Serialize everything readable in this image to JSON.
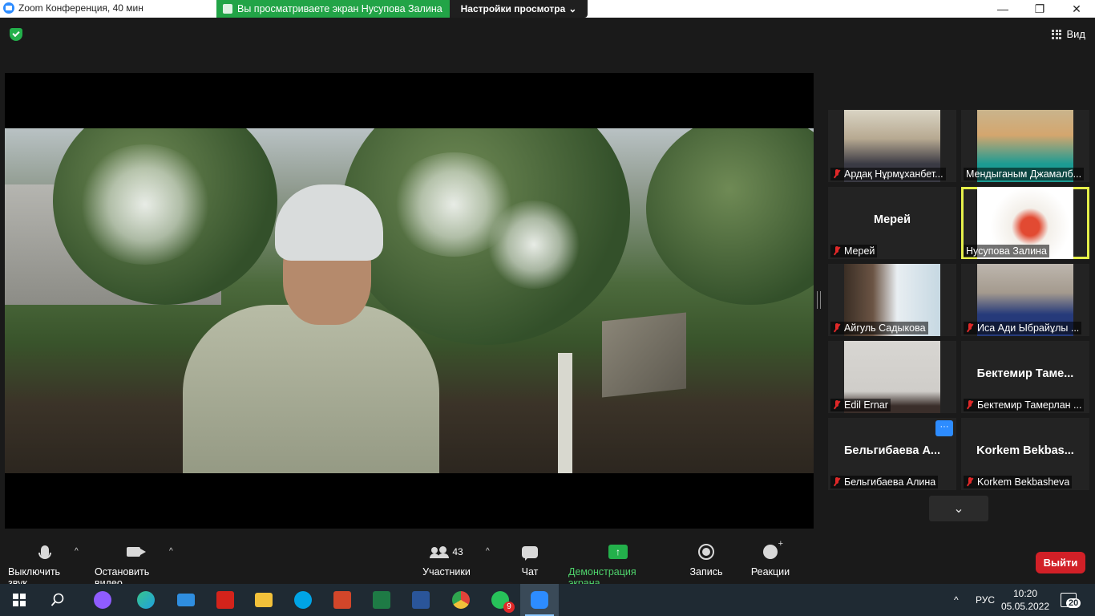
{
  "window": {
    "title": "Zoom Конференция, 40 мин",
    "share_banner": "Вы просматриваете экран Нусупова Залина",
    "view_settings": "Настройки просмотра",
    "view_button": "Вид",
    "minimize": "—",
    "maximize": "❐",
    "close": "✕"
  },
  "participants": [
    {
      "label": "Ардақ Нұрмұханбет...",
      "video": true,
      "muted": true
    },
    {
      "label": "Мендыганым Джамалб...",
      "video": true,
      "muted": false
    },
    {
      "label": "Мерей",
      "display_name": "Мерей",
      "video": false,
      "muted": true
    },
    {
      "label": "Нусупова Залина",
      "video": true,
      "muted": false,
      "active_speaker": true
    },
    {
      "label": "Айгуль Садыкова",
      "video": true,
      "muted": true
    },
    {
      "label": "Иса Ади Ыбрайұлы ...",
      "video": true,
      "muted": true
    },
    {
      "label": "Edil Ernar",
      "video": true,
      "muted": true
    },
    {
      "label": "Бектемир Тамерлан ...",
      "display_name": "Бектемир Таме...",
      "video": false,
      "muted": true
    },
    {
      "label": "Бельгибаева Алина",
      "display_name": "Бельгибаева А...",
      "video": false,
      "muted": true,
      "more_button": "···"
    },
    {
      "label": "Korkem Bekbasheva",
      "display_name": "Korkem Bekbas...",
      "video": false,
      "muted": true
    }
  ],
  "gallery_scroll": "⌄",
  "toolbar": {
    "mute_label": "Выключить звук",
    "video_label": "Остановить видео",
    "participants_label": "Участники",
    "participants_count": "43",
    "chat_label": "Чат",
    "share_label": "Демонстрация экрана",
    "share_icon": "↑",
    "record_label": "Запись",
    "reactions_label": "Реакции",
    "leave_label": "Выйти",
    "caret": "^"
  },
  "taskbar": {
    "language": "РУС",
    "time": "10:20",
    "date": "05.05.2022",
    "notifications": "20",
    "whatsapp_badge": "9",
    "tray_caret": "^",
    "apps": [
      {
        "name": "start",
        "color": "#ffffff"
      },
      {
        "name": "search",
        "color": "#ffffff"
      },
      {
        "name": "alice",
        "color": "#8f5cff"
      },
      {
        "name": "edge",
        "color": "#1fa0e0"
      },
      {
        "name": "mail",
        "color": "#2f8ee0"
      },
      {
        "name": "acrobat",
        "color": "#d3231b"
      },
      {
        "name": "explorer",
        "color": "#f3c13a"
      },
      {
        "name": "skype",
        "color": "#00a4e6"
      },
      {
        "name": "powerpoint",
        "color": "#d2462a"
      },
      {
        "name": "excel",
        "color": "#1e7a45"
      },
      {
        "name": "word",
        "color": "#2a5599"
      },
      {
        "name": "chrome",
        "color": "#e8a92a"
      },
      {
        "name": "whatsapp",
        "color": "#27c25a"
      },
      {
        "name": "zoom",
        "color": "#2d8cff"
      }
    ]
  },
  "colors": {
    "accent": "#2d8cff",
    "share_green": "#22a447",
    "leave_red": "#d22027",
    "active_border": "#e6f04a"
  }
}
